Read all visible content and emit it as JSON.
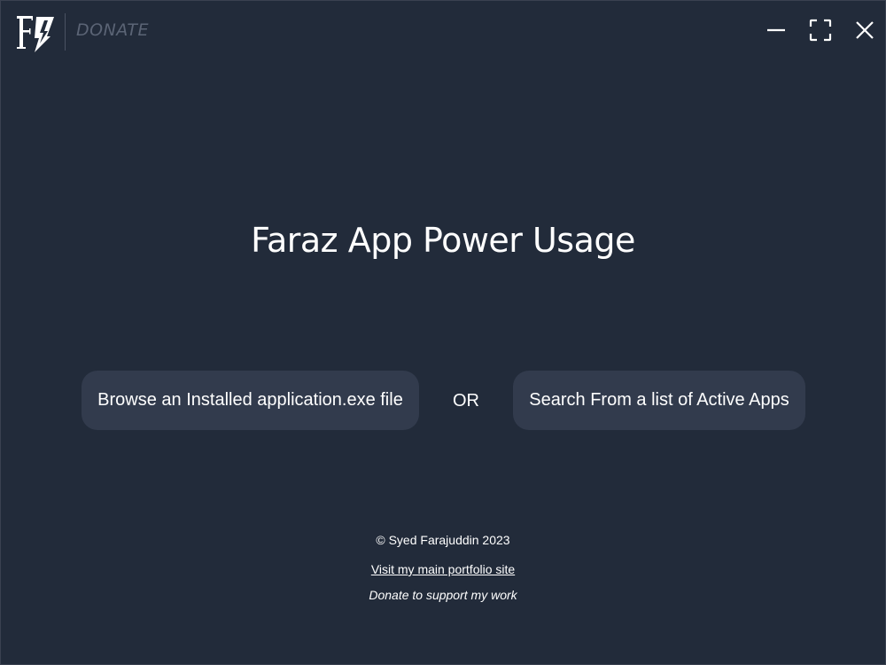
{
  "header": {
    "logo_icon": "faraz-lightning-logo-icon",
    "donate_label": "DONATE",
    "window_controls": {
      "minimize_icon": "minimize-icon",
      "maximize_icon": "fullscreen-icon",
      "close_icon": "close-icon"
    }
  },
  "main": {
    "title": "Faraz App Power Usage",
    "browse_button_label": "Browse an Installed application.exe file",
    "or_label": "OR",
    "search_button_label": "Search From a list of Active Apps"
  },
  "footer": {
    "copyright": "© Syed Farajuddin 2023",
    "portfolio_link": "Visit my main portfolio site",
    "donate_link": "Donate to support my work"
  },
  "colors": {
    "window_background": "#222b3a",
    "button_background": "#323b4d",
    "donate_text": "#5b6475",
    "text": "#ffffff"
  }
}
